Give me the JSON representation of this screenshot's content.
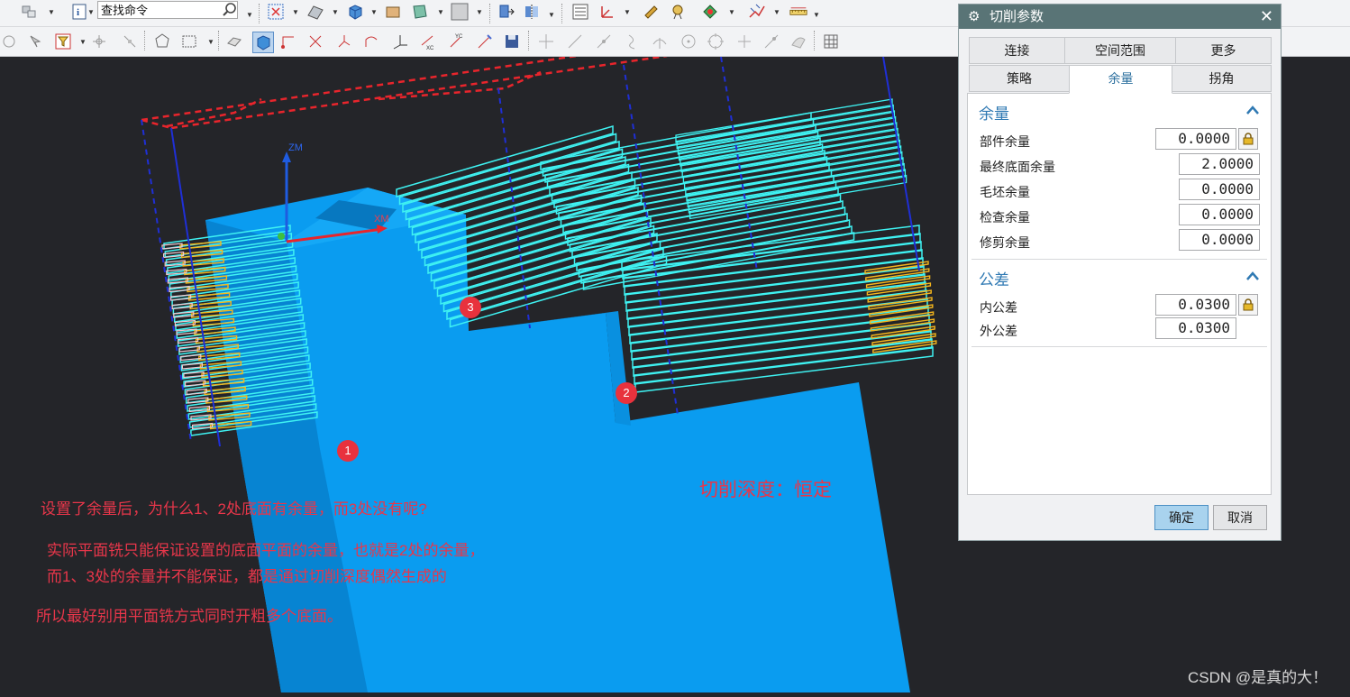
{
  "toolbar": {
    "search_placeholder": "查找命令"
  },
  "viewport": {
    "axis_zm": "ZM",
    "axis_xm": "XM",
    "markers": [
      "1",
      "2",
      "3"
    ],
    "annotations": {
      "question": "设置了余量后，为什么1、2处底面有余量，而3处没有呢?",
      "explain_line1": "实际平面铣只能保证设置的底面平面的余量，也就是2处的余量，",
      "explain_line2": "而1、3处的余量并不能保证，都是通过切削深度偶然生成的",
      "conclusion": "所以最好别用平面铣方式同时开粗多个底面。",
      "depth_note": "切削深度：恒定"
    },
    "colors": {
      "background": "#242529",
      "part": "#0a9cf0",
      "toolpath": "#3ff2f2",
      "annotation": "#e8364a"
    }
  },
  "dialog": {
    "title": "切削参数",
    "close_glyph": "✕",
    "tabs_row1": [
      "连接",
      "空间范围",
      "更多"
    ],
    "tabs_row2": [
      "策略",
      "余量",
      "拐角"
    ],
    "active_tab": "余量",
    "allowance": {
      "header": "余量",
      "fields": [
        {
          "label": "部件余量",
          "value": "0.0000",
          "locked": true
        },
        {
          "label": "最终底面余量",
          "value": "2.0000"
        },
        {
          "label": "毛坯余量",
          "value": "0.0000"
        },
        {
          "label": "检查余量",
          "value": "0.0000"
        },
        {
          "label": "修剪余量",
          "value": "0.0000"
        }
      ]
    },
    "tolerance": {
      "header": "公差",
      "fields": [
        {
          "label": "内公差",
          "value": "0.0300",
          "locked": true
        },
        {
          "label": "外公差",
          "value": "0.0300"
        }
      ]
    },
    "ok_label": "确定",
    "cancel_label": "取消"
  },
  "watermark": "CSDN @是真的大！"
}
